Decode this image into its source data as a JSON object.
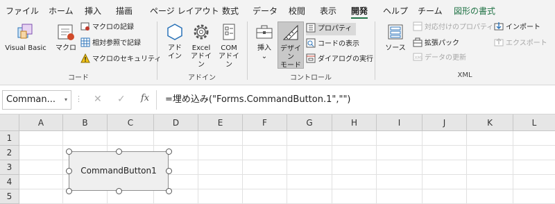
{
  "tabs": [
    {
      "label": "ファイル"
    },
    {
      "label": "ホーム"
    },
    {
      "label": "挿入"
    },
    {
      "label": "描画"
    },
    {
      "label": "ページ レイアウト"
    },
    {
      "label": "数式"
    },
    {
      "label": "データ"
    },
    {
      "label": "校閲"
    },
    {
      "label": "表示"
    },
    {
      "label": "開発"
    },
    {
      "label": "ヘルプ"
    },
    {
      "label": "チーム"
    },
    {
      "label": "図形の書式"
    }
  ],
  "active_tab": "開発",
  "ribbon": {
    "code": {
      "group_label": "コード",
      "visual_basic": "Visual Basic",
      "macro": "マクロ",
      "record_macro": "マクロの記録",
      "relative_ref": "相対参照で記録",
      "macro_security": "マクロのセキュリティ"
    },
    "addins": {
      "group_label": "アドイン",
      "addin_line1": "アド",
      "addin_line2": "イン",
      "excel_addin_line1": "Excel",
      "excel_addin_line2": "アドイン",
      "com_addin_line1": "COM",
      "com_addin_line2": "アドイン"
    },
    "controls": {
      "group_label": "コントロール",
      "insert": "挿入",
      "insert_arrow": "⌄",
      "design_line1": "デザイン",
      "design_line2": "モード",
      "properties": "プロパティ",
      "view_code": "コードの表示",
      "run_dialog": "ダイアログの実行"
    },
    "xml": {
      "group_label": "XML",
      "source": "ソース",
      "map_properties": "対応付けのプロパティ",
      "expansion_packs": "拡張パック",
      "refresh_data": "データの更新",
      "import": "インポート",
      "export": "エクスポート"
    }
  },
  "formula_bar": {
    "name_box": "Comman...",
    "name_box_arrow": "▾",
    "dots": "⋮",
    "cancel": "✕",
    "enter": "✓",
    "fx": "fx",
    "formula": "=埋め込み(\"Forms.CommandButton.1\",\"\")"
  },
  "grid": {
    "columns": [
      "A",
      "B",
      "C",
      "D",
      "E",
      "F",
      "G",
      "H",
      "I",
      "J",
      "K",
      "L"
    ],
    "rows": [
      "1",
      "2",
      "3",
      "4",
      "5"
    ]
  },
  "command_button": {
    "caption": "CommandButton1"
  },
  "colors": {
    "accent_green": "#217346",
    "ribbon_bg": "#f3f3f3"
  }
}
